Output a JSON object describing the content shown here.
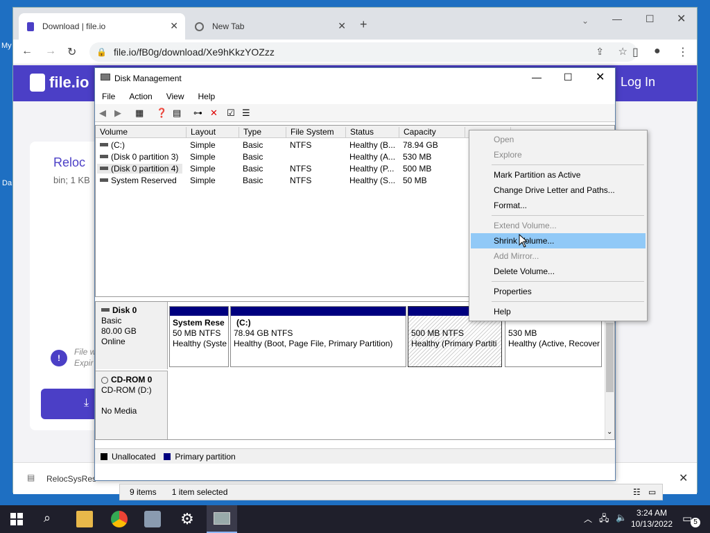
{
  "desktop": {
    "labels": [
      "My",
      "Da"
    ]
  },
  "browser": {
    "tabs": [
      {
        "title": "Download | file.io"
      },
      {
        "title": "New Tab"
      }
    ],
    "url": "file.io/fB0g/download/Xe9hKkzYOZzz",
    "page": {
      "brand": "file.io",
      "login": "Log In",
      "file_name": "Reloc",
      "file_meta": "bin; 1 KB",
      "file_note": "File w",
      "file_note2": "Expir",
      "download_bar_file": "RelocSysRes"
    }
  },
  "dm": {
    "title": "Disk Management",
    "menu": [
      "File",
      "Action",
      "View",
      "Help"
    ],
    "columns": [
      "Volume",
      "Layout",
      "Type",
      "File System",
      "Status",
      "Capacity"
    ],
    "volumes": [
      {
        "volume": "(C:)",
        "layout": "Simple",
        "type": "Basic",
        "fs": "NTFS",
        "status": "Healthy (B...",
        "capacity": "78.94 GB"
      },
      {
        "volume": "(Disk 0 partition 3)",
        "layout": "Simple",
        "type": "Basic",
        "fs": "",
        "status": "Healthy (A...",
        "capacity": "530 MB"
      },
      {
        "volume": "(Disk 0 partition 4)",
        "layout": "Simple",
        "type": "Basic",
        "fs": "NTFS",
        "status": "Healthy (P...",
        "capacity": "500 MB"
      },
      {
        "volume": "System Reserved",
        "layout": "Simple",
        "type": "Basic",
        "fs": "NTFS",
        "status": "Healthy (S...",
        "capacity": "50 MB"
      }
    ],
    "disk0": {
      "name": "Disk 0",
      "type": "Basic",
      "size": "80.00 GB",
      "state": "Online"
    },
    "partitions": [
      {
        "name": "System Rese",
        "size": "50 MB NTFS",
        "status": "Healthy (Syste"
      },
      {
        "name": "(C:)",
        "size": "78.94 GB NTFS",
        "status": "Healthy (Boot, Page File, Primary Partition)"
      },
      {
        "name": "",
        "size": "500 MB NTFS",
        "status": "Healthy (Primary Partiti"
      },
      {
        "name": "",
        "size": "530 MB",
        "status": "Healthy (Active, Recover"
      }
    ],
    "cdrom": {
      "name": "CD-ROM 0",
      "type": "CD-ROM (D:)",
      "media": "No Media"
    },
    "legend": {
      "unallocated": "Unallocated",
      "primary": "Primary partition"
    },
    "status": {
      "items": "9 items",
      "selected": "1 item selected"
    }
  },
  "context_menu": {
    "items": [
      {
        "label": "Open",
        "disabled": true
      },
      {
        "label": "Explore",
        "disabled": true
      },
      {
        "label": "Mark Partition as Active",
        "disabled": false
      },
      {
        "label": "Change Drive Letter and Paths...",
        "disabled": false
      },
      {
        "label": "Format...",
        "disabled": false
      },
      {
        "label": "Extend Volume...",
        "disabled": true
      },
      {
        "label": "Shrink Volume...",
        "disabled": false
      },
      {
        "label": "Add Mirror...",
        "disabled": true
      },
      {
        "label": "Delete Volume...",
        "disabled": false
      },
      {
        "label": "Properties",
        "disabled": false
      },
      {
        "label": "Help",
        "disabled": false
      }
    ]
  },
  "taskbar": {
    "time": "3:24 AM",
    "date": "10/13/2022",
    "notifications": "5"
  },
  "colors": {
    "primary_partition": "#00007f",
    "unallocated": "#000000",
    "highlight": "#91c9f7",
    "fileio": "#4b3fc6"
  }
}
